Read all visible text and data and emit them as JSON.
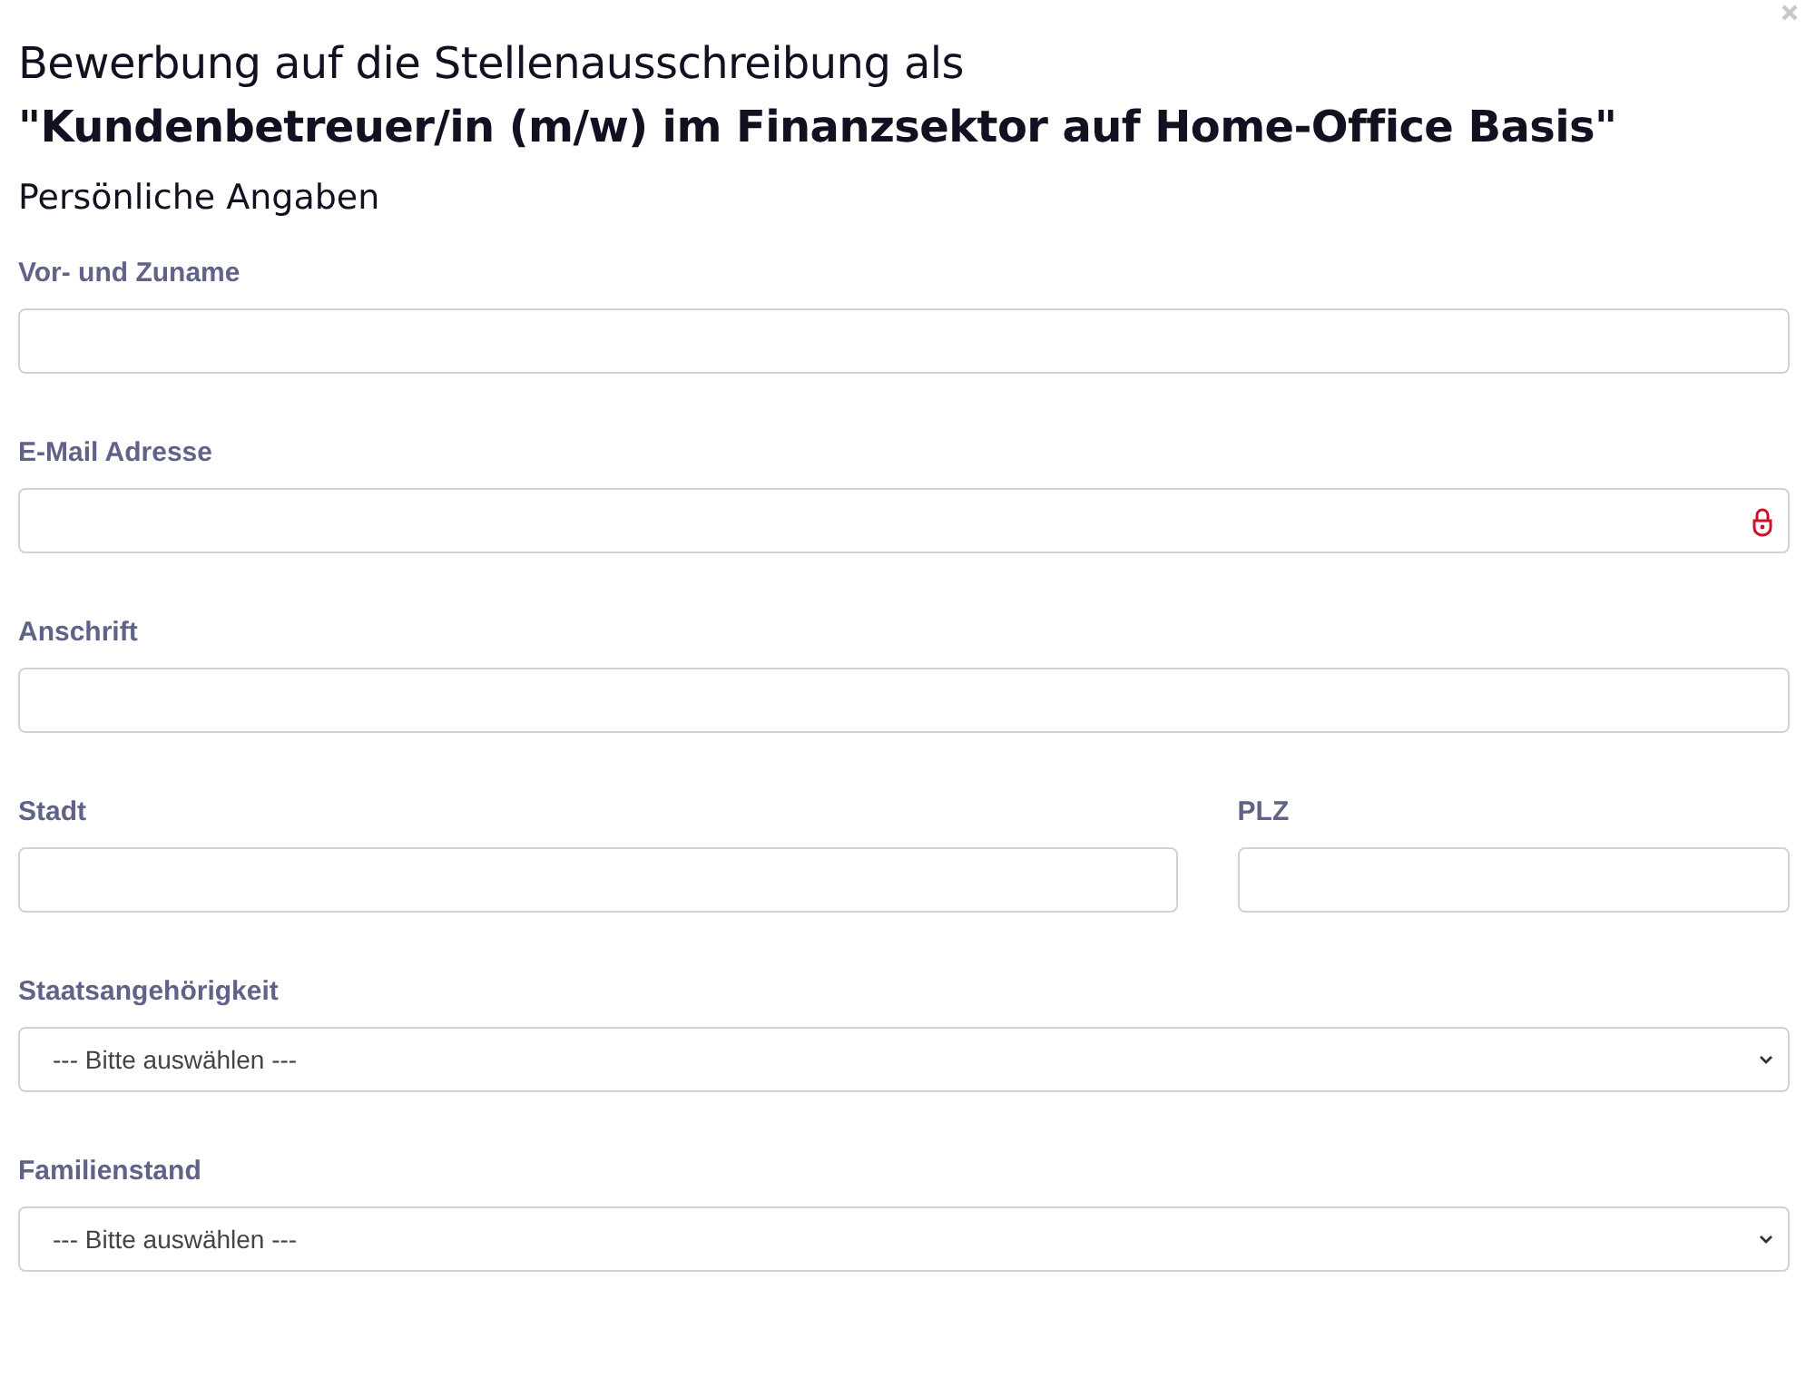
{
  "title": "Bewerbung auf die Stellenausschreibung als **\"Kundenbetreuer/in (m/w) im Finanzsektor auf Home-Office Basis\"**",
  "section": "Persönliche Angaben",
  "rows": [
    {
      "fields": [
        {
          "label": "Vor- und Zuname",
          "kind": "text"
        }
      ]
    },
    {
      "fields": [
        {
          "label": "E-Mail Adresse",
          "kind": "email"
        }
      ]
    },
    {
      "fields": [
        {
          "label": "Anschrift",
          "kind": "text"
        }
      ]
    },
    {
      "fields": [
        {
          "label": "Stadt",
          "kind": "text"
        },
        {
          "label": "PLZ",
          "kind": "text"
        }
      ]
    },
    {
      "fields": [
        {
          "label": "Staatsangehörigkeit",
          "kind": "select",
          "value": "--- Bitte auswählen ---"
        }
      ]
    },
    {
      "fields": [
        {
          "label": "Familienstand",
          "kind": "select",
          "value": "--- Bitte auswählen ---"
        }
      ]
    }
  ]
}
